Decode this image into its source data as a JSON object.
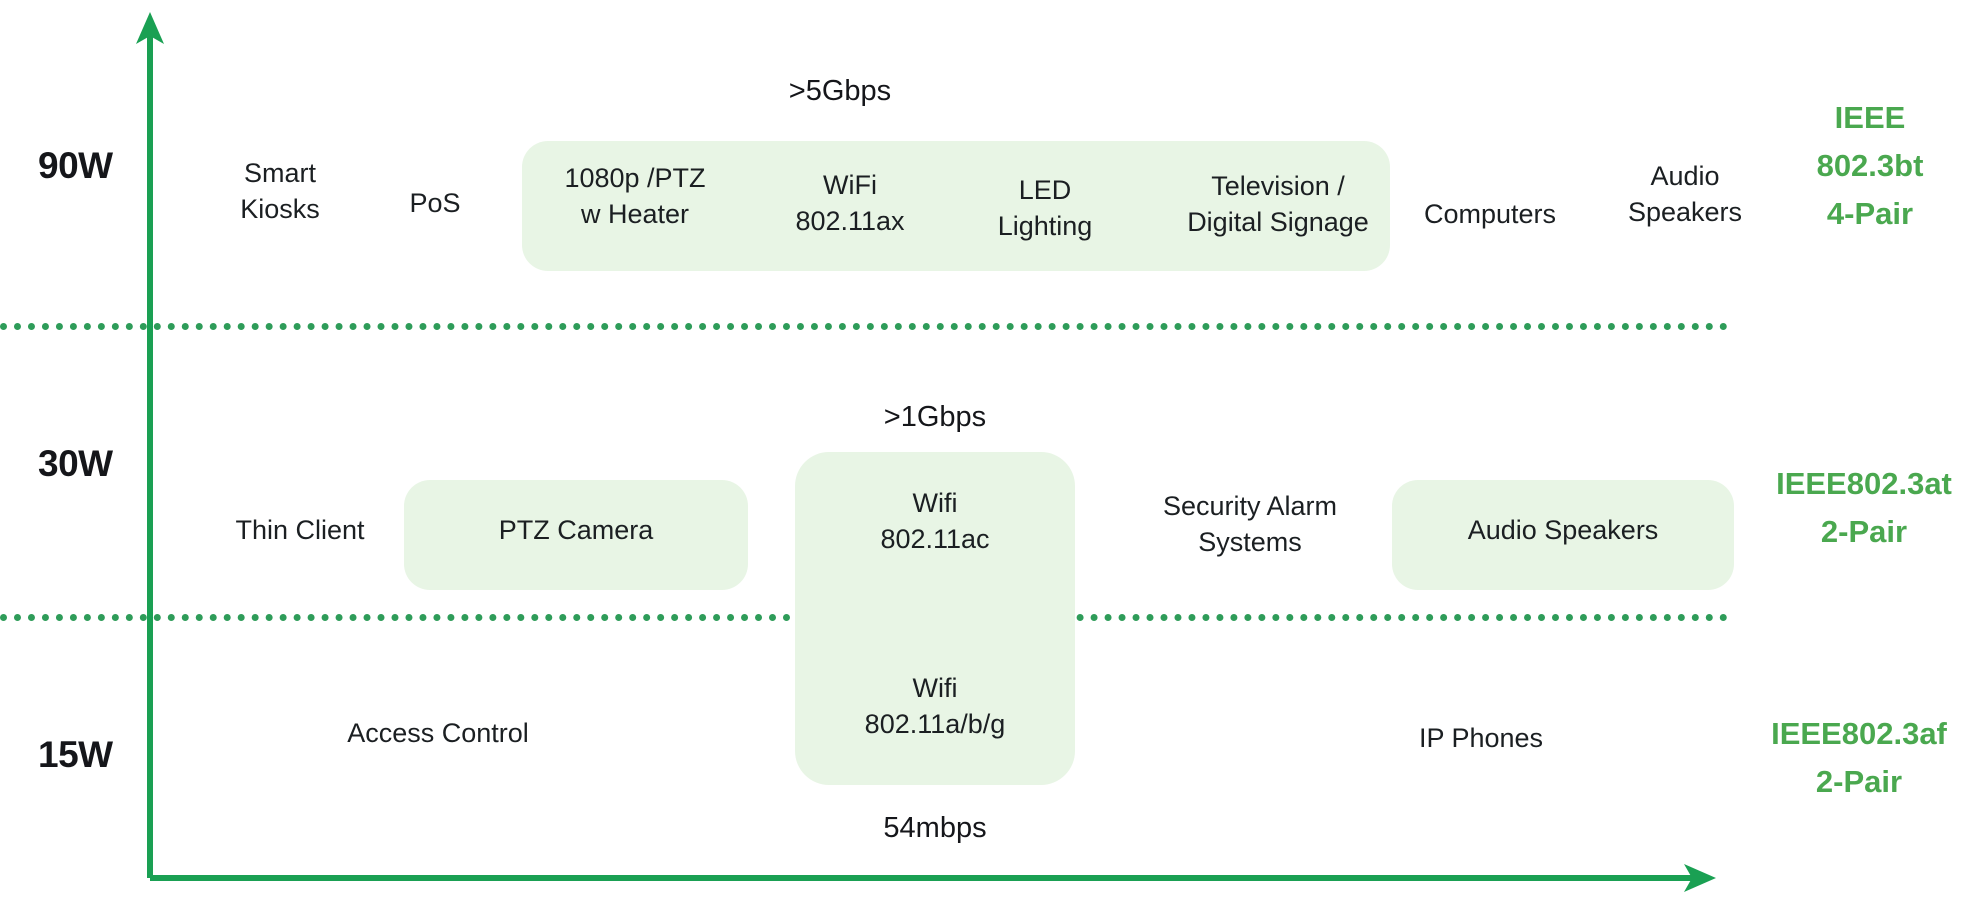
{
  "diagram": {
    "title": "PoE Power Tiers and Device Classes",
    "colors": {
      "axis": "#1aa053",
      "divider": "#2e9c59",
      "highlight_box": "#e8f5e5",
      "standard_text": "#4aa84f",
      "device_text": "#1b1f22"
    },
    "axes": {
      "y_axis_name": "power-axis-arrow-up",
      "x_axis_name": "bandwidth-axis-arrow-right"
    },
    "tiers": [
      {
        "power": "90W",
        "standard_lines": [
          "IEEE",
          "802.3bt",
          "4-Pair"
        ],
        "speed_annotation": ">5Gbps",
        "devices": [
          {
            "label": "Smart Kiosks",
            "lines": [
              "Smart",
              "Kiosks"
            ],
            "boxed": false
          },
          {
            "label": "PoS",
            "lines": [
              "PoS"
            ],
            "boxed": false
          },
          {
            "label": "1080p /PTZ w Heater",
            "lines": [
              "1080p /PTZ",
              "w Heater"
            ],
            "boxed": true
          },
          {
            "label": "WiFi 802.11ax",
            "lines": [
              "WiFi",
              "802.11ax"
            ],
            "boxed": true
          },
          {
            "label": "LED Lighting",
            "lines": [
              "LED",
              "Lighting"
            ],
            "boxed": true
          },
          {
            "label": "Television / Digital Signage",
            "lines": [
              "Television /",
              "Digital Signage"
            ],
            "boxed": true
          },
          {
            "label": "Computers",
            "lines": [
              "Computers"
            ],
            "boxed": false
          },
          {
            "label": "Audio Speakers",
            "lines": [
              "Audio",
              "Speakers"
            ],
            "boxed": false
          }
        ]
      },
      {
        "power": "30W",
        "standard_lines": [
          "IEEE802.3at",
          "2-Pair"
        ],
        "speed_annotation": ">1Gbps",
        "devices": [
          {
            "label": "Thin Client",
            "lines": [
              "Thin Client"
            ],
            "boxed": false
          },
          {
            "label": "PTZ Camera",
            "lines": [
              "PTZ Camera"
            ],
            "boxed": true
          },
          {
            "label": "Wifi 802.11ac",
            "lines": [
              "Wifi",
              "802.11ac"
            ],
            "boxed": true
          },
          {
            "label": "Security Alarm Systems",
            "lines": [
              "Security Alarm",
              "Systems"
            ],
            "boxed": false
          },
          {
            "label": "Audio Speakers",
            "lines": [
              "Audio Speakers"
            ],
            "boxed": true
          }
        ]
      },
      {
        "power": "15W",
        "standard_lines": [
          "IEEE802.3af",
          "2-Pair"
        ],
        "speed_annotation": "54mbps",
        "devices": [
          {
            "label": "Access Control",
            "lines": [
              "Access Control"
            ],
            "boxed": false
          },
          {
            "label": "Wifi 802.11a/b/g",
            "lines": [
              "Wifi",
              "802.11a/b/g"
            ],
            "boxed": true
          },
          {
            "label": "IP Phones",
            "lines": [
              "IP Phones"
            ],
            "boxed": false
          }
        ]
      }
    ],
    "labels": {
      "tier1_power": "90W",
      "tier2_power": "30W",
      "tier3_power": "15W",
      "tier1_std_1": "IEEE",
      "tier1_std_2": "802.3bt",
      "tier1_std_3": "4-Pair",
      "tier2_std_1": "IEEE802.3at",
      "tier2_std_2": "2-Pair",
      "tier3_std_1": "IEEE802.3af",
      "tier3_std_2": "2-Pair",
      "speed_top": ">5Gbps",
      "speed_mid": ">1Gbps",
      "speed_bottom": "54mbps",
      "t1_d1_l1": "Smart",
      "t1_d1_l2": "Kiosks",
      "t1_d2_l1": "PoS",
      "t1_d3_l1": "1080p /PTZ",
      "t1_d3_l2": "w Heater",
      "t1_d4_l1": "WiFi",
      "t1_d4_l2": "802.11ax",
      "t1_d5_l1": "LED",
      "t1_d5_l2": "Lighting",
      "t1_d6_l1": "Television /",
      "t1_d6_l2": "Digital Signage",
      "t1_d7_l1": "Computers",
      "t1_d8_l1": "Audio",
      "t1_d8_l2": "Speakers",
      "t2_d1_l1": "Thin Client",
      "t2_d2_l1": "PTZ Camera",
      "t2_d3_l1": "Wifi",
      "t2_d3_l2": "802.11ac",
      "t2_d4_l1": "Security Alarm",
      "t2_d4_l2": "Systems",
      "t2_d5_l1": "Audio Speakers",
      "t3_d1_l1": "Access Control",
      "t3_d2_l1": "Wifi",
      "t3_d2_l2": "802.11a/b/g",
      "t3_d3_l1": "IP Phones"
    }
  }
}
